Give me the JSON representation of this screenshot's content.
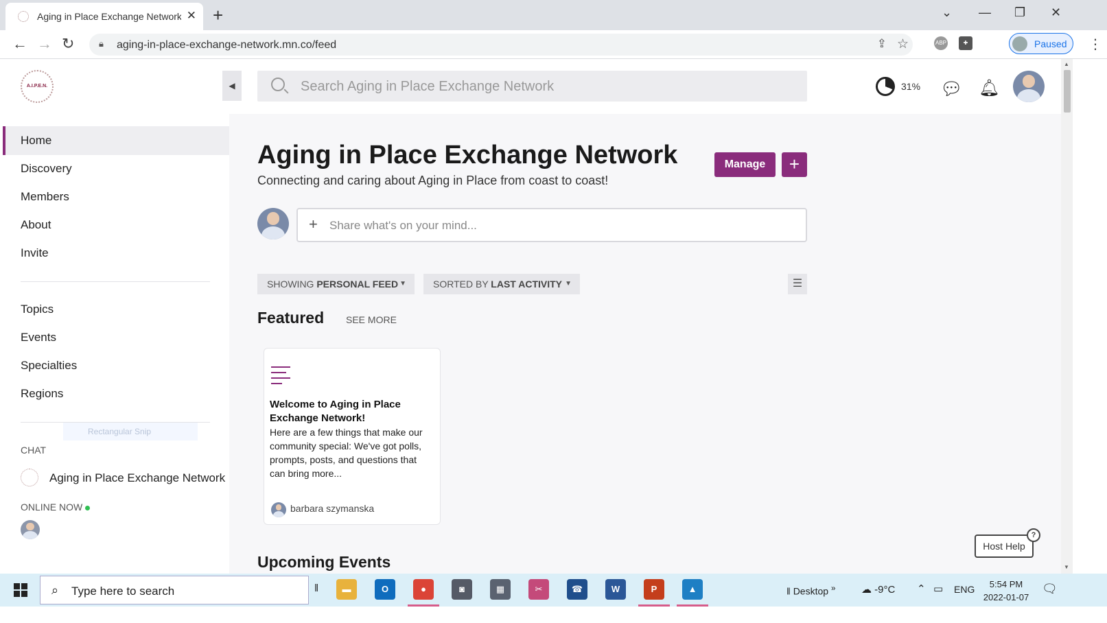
{
  "browser": {
    "tab_title": "Aging in Place Exchange Network",
    "new_tab": "+",
    "close_tab": "✕",
    "url": "aging-in-place-exchange-network.mn.co/feed",
    "profile_status": "Paused",
    "window_controls": [
      "⌄",
      "—",
      "❐",
      "✕"
    ],
    "extensions": [
      "ABP",
      "puzzle-icon"
    ]
  },
  "sidebar": {
    "logo_text": "A.I.P.E.N.",
    "nav_items": [
      {
        "label": "Home",
        "active": true
      },
      {
        "label": "Discovery",
        "active": false
      },
      {
        "label": "Members",
        "active": false
      },
      {
        "label": "About",
        "active": false
      },
      {
        "label": "Invite",
        "active": false
      }
    ],
    "section_items": [
      {
        "label": "Topics"
      },
      {
        "label": "Events"
      },
      {
        "label": "Specialties"
      },
      {
        "label": "Regions"
      }
    ],
    "chat_title": "CHAT",
    "chat_item": "Aging in Place Exchange Network",
    "online_title": "ONLINE NOW",
    "snip_overlay": "Rectangular Snip"
  },
  "header": {
    "search_placeholder": "Search Aging in Place Exchange Network",
    "progress_percent": "31%",
    "progress_value": 0.31
  },
  "main": {
    "title": "Aging in Place Exchange Network",
    "subtitle": "Connecting and caring about Aging in Place from coast to coast!",
    "manage_label": "Manage",
    "plus_label": "+",
    "composer_placeholder": "Share what's on your mind...",
    "filters": [
      {
        "prefix": "SHOWING",
        "value": "PERSONAL FEED"
      },
      {
        "prefix": "SORTED BY",
        "value": "LAST ACTIVITY"
      }
    ],
    "featured_title": "Featured",
    "see_more": "SEE MORE",
    "featured_card": {
      "title": "Welcome to Aging in Place Exchange Network!",
      "body": "Here are a few things that make our community special: We've got polls, prompts, posts, and questions that can bring more...",
      "author": "barbara szymanska"
    },
    "upcoming_title": "Upcoming Events",
    "host_help": "Host Help",
    "host_help_q": "?"
  },
  "taskbar": {
    "search_placeholder": "Type here to search",
    "apps": [
      {
        "name": "file-explorer",
        "color": "#e8b23c",
        "glyph": "▬"
      },
      {
        "name": "outlook",
        "color": "#0f6cbd",
        "glyph": "O"
      },
      {
        "name": "chrome",
        "color": "#db4437",
        "glyph": "●",
        "active": true
      },
      {
        "name": "camera",
        "color": "#555a66",
        "glyph": "◙"
      },
      {
        "name": "calculator",
        "color": "#5a6270",
        "glyph": "▦"
      },
      {
        "name": "snipping-tool",
        "color": "#c44a7a",
        "glyph": "✂"
      },
      {
        "name": "phone-link",
        "color": "#1f4e8c",
        "glyph": "☎"
      },
      {
        "name": "word",
        "color": "#2b5797",
        "glyph": "W"
      },
      {
        "name": "powerpoint",
        "color": "#c43e1c",
        "glyph": "P",
        "active": true
      },
      {
        "name": "photos",
        "color": "#1e7fc4",
        "glyph": "▲",
        "active": true
      }
    ],
    "desktop_label": "Desktop",
    "weather": "-9°C",
    "language": "ENG",
    "time": "5:54 PM",
    "date": "2022-01-07"
  },
  "colors": {
    "accent": "#8a2c7c",
    "online": "#2fbf52",
    "taskbar": "#dbeff8"
  }
}
